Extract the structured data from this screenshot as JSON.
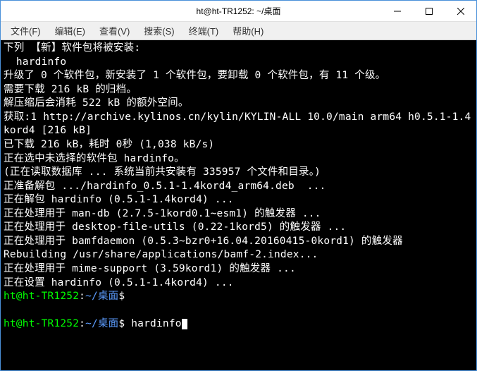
{
  "window": {
    "title": "ht@ht-TR1252: ~/桌面"
  },
  "menubar": {
    "items": [
      "文件(F)",
      "编辑(E)",
      "查看(V)",
      "搜索(S)",
      "终端(T)",
      "帮助(H)"
    ]
  },
  "terminal": {
    "lines": [
      "下列 【新】软件包将被安装:",
      "  hardinfo",
      "升级了 0 个软件包，新安装了 1 个软件包，要卸载 0 个软件包，有 11 个级。",
      "需要下载 216 kB 的归档。",
      "解压缩后会消耗 522 kB 的额外空间。",
      "获取:1 http://archive.kylinos.cn/kylin/KYLIN-ALL 10.0/main arm64 h0.5.1-1.4kord4 [216 kB]",
      "已下载 216 kB，耗时 0秒 (1,038 kB/s)",
      "正在选中未选择的软件包 hardinfo。",
      "(正在读取数据库 ... 系统当前共安装有 335957 个文件和目录。)",
      "正准备解包 .../hardinfo_0.5.1-1.4kord4_arm64.deb  ...",
      "正在解包 hardinfo (0.5.1-1.4kord4) ...",
      "正在处理用于 man-db (2.7.5-1kord0.1~esm1) 的触发器 ...",
      "正在处理用于 desktop-file-utils (0.22-1kord5) 的触发器 ...",
      "正在处理用于 bamfdaemon (0.5.3~bzr0+16.04.20160415-0kord1) 的触发器",
      "Rebuilding /usr/share/applications/bamf-2.index...",
      "正在处理用于 mime-support (3.59kord1) 的触发器 ...",
      "正在设置 hardinfo (0.5.1-1.4kord4) ..."
    ],
    "prompt1": {
      "user": "ht@ht-TR1252",
      "sep": ":",
      "path": "~/桌面",
      "symbol": "$",
      "command": ""
    },
    "prompt2": {
      "user": "ht@ht-TR1252",
      "sep": ":",
      "path": "~/桌面",
      "symbol": "$",
      "command": "hardinfo"
    }
  }
}
